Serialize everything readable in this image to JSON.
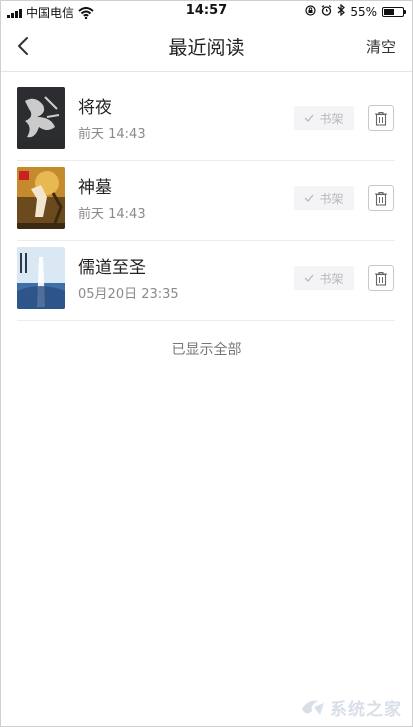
{
  "status_bar": {
    "carrier": "中国电信",
    "time": "14:57",
    "battery_percent": "55%",
    "battery_level": 0.55
  },
  "nav": {
    "title": "最近阅读",
    "clear_label": "清空"
  },
  "books": [
    {
      "title": "将夜",
      "time": "前天 14:43",
      "shelf_label": "书架"
    },
    {
      "title": "神墓",
      "time": "前天 14:43",
      "shelf_label": "书架"
    },
    {
      "title": "儒道至圣",
      "time": "05月20日 23:35",
      "shelf_label": "书架"
    }
  ],
  "footer_note": "已显示全部",
  "watermark": "系统之家",
  "colors": {
    "shelf_button_bg": "#f4f4f6",
    "shelf_button_text": "#b8b8bd",
    "divider": "#ececec"
  }
}
